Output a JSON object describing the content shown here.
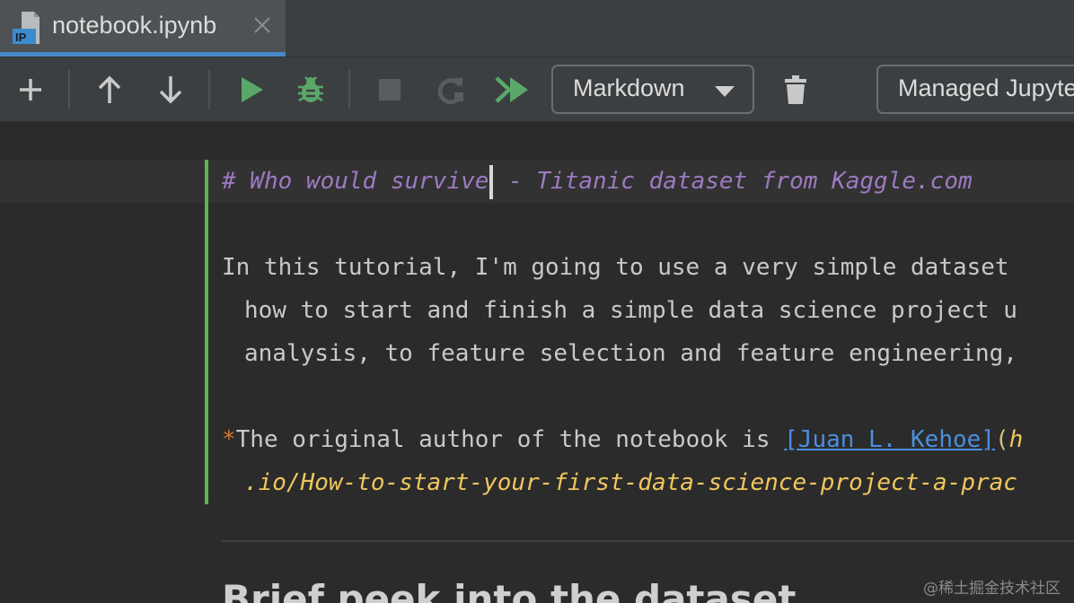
{
  "tab": {
    "title": "notebook.ipynb",
    "icon_text": "IP"
  },
  "toolbar": {
    "cell_type": "Markdown",
    "server": "Managed Jupyter"
  },
  "cell": {
    "heading_before_caret": "# Who would survive",
    "heading_after_caret": " - Titanic dataset from Kaggle.com",
    "para1_line1": "In this tutorial, I'm going to use a very simple dataset",
    "para1_line2": "how to start and finish a simple data science project u",
    "para1_line3": "analysis, to feature selection and feature engineering,",
    "para2_star": "*",
    "para2_text": "The original author of the notebook is ",
    "para2_link": "[Juan L. Kehoe]",
    "para2_paren": "(",
    "para2_url_start": "h",
    "para2_line2": ".io/How-to-start-your-first-data-science-project-a-prac"
  },
  "next_heading": "Brief peek into the dataset",
  "watermark": "@稀土掘金技术社区",
  "colors": {
    "run": "#59a869",
    "accent": "#4a88c7",
    "cell_bar": "#5fb356",
    "heading": "#9d7ac2",
    "link": "#4a8fdd"
  }
}
